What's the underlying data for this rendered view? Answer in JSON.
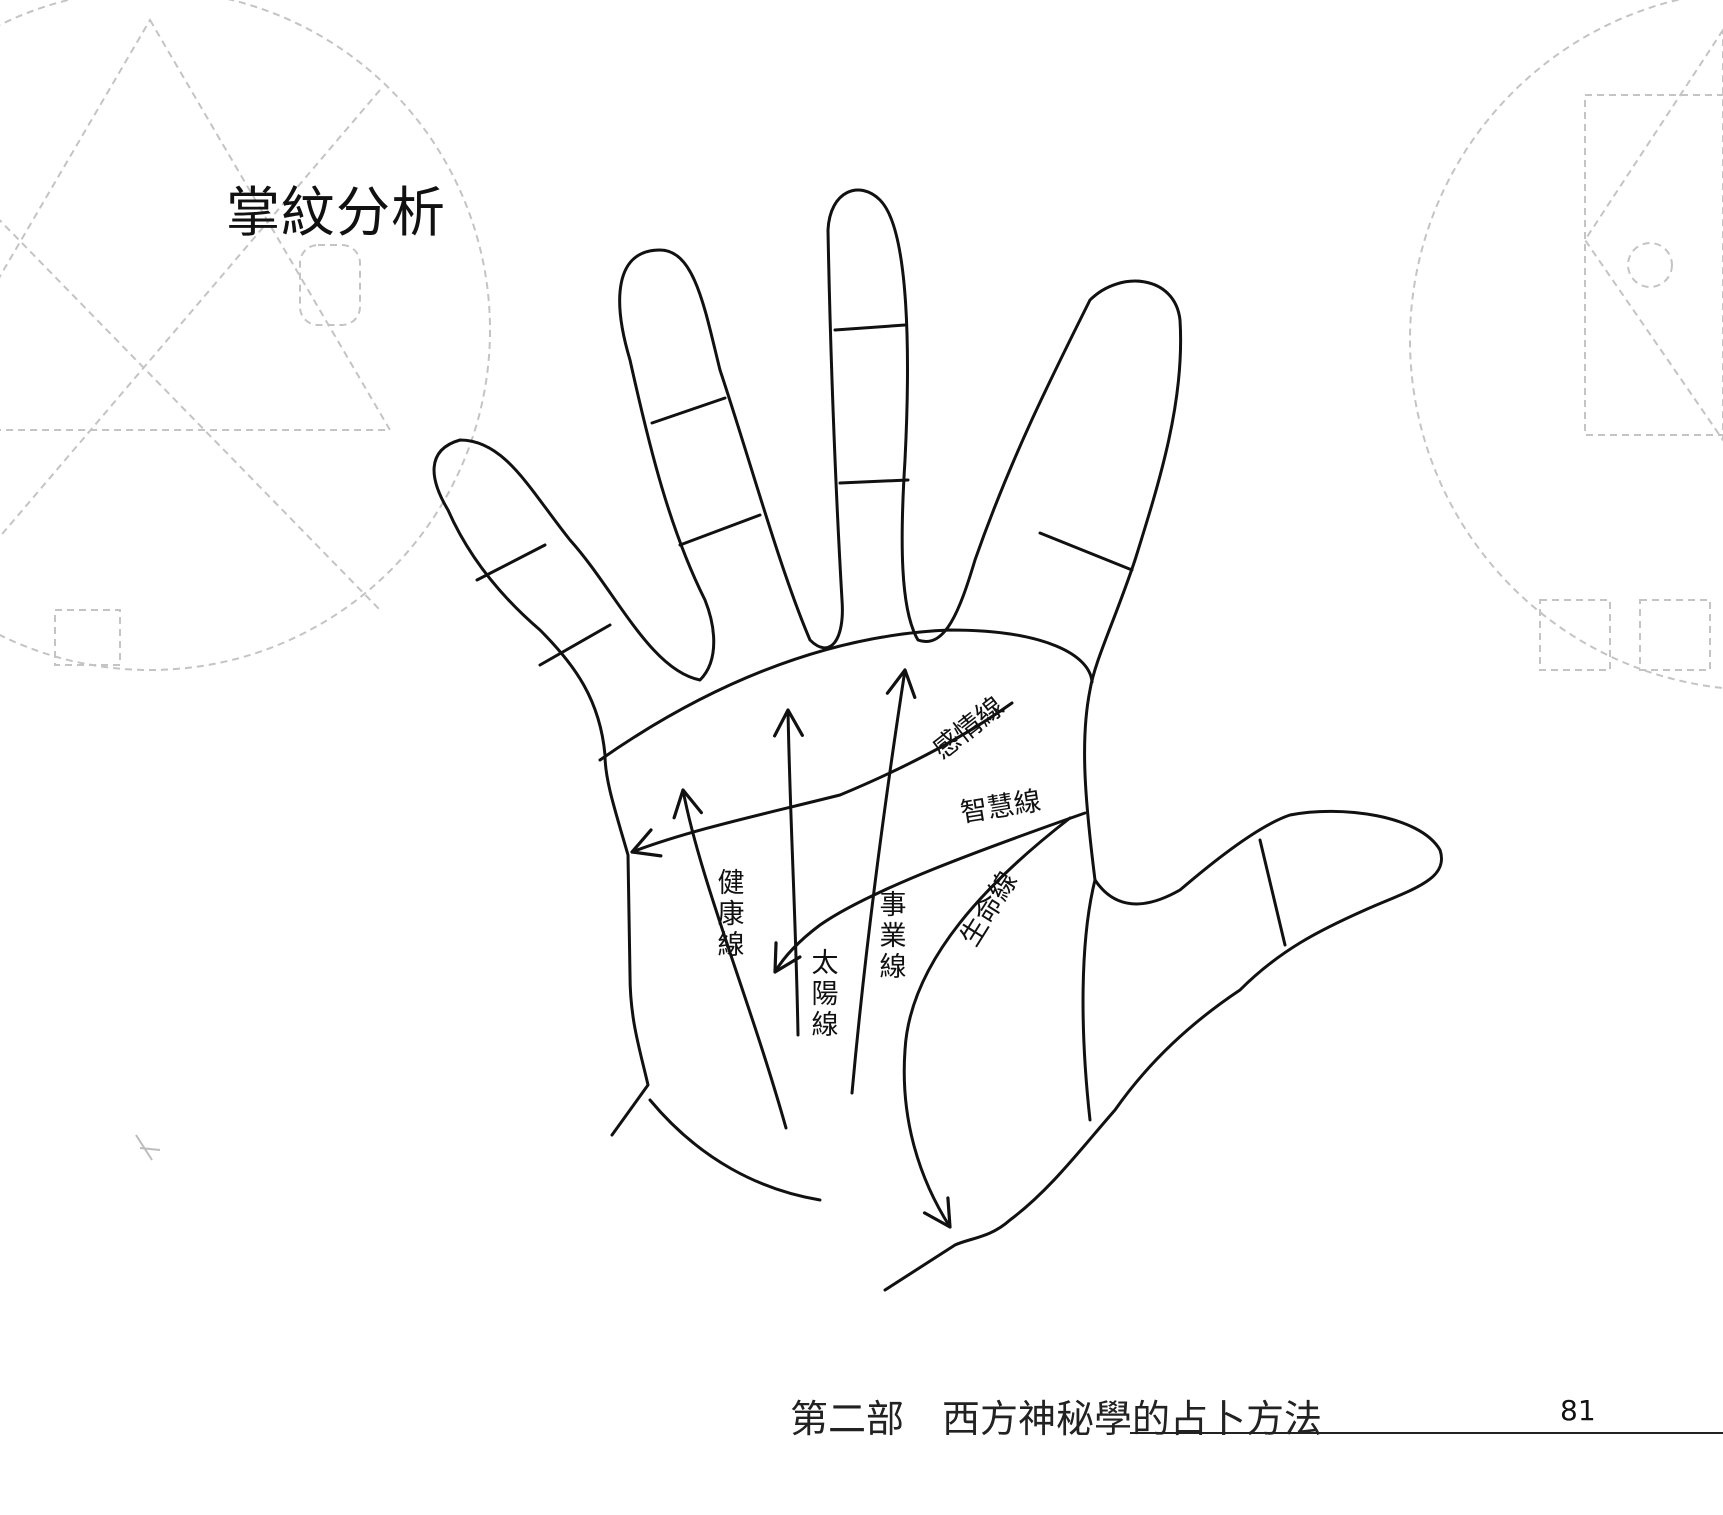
{
  "title": "掌紋分析",
  "lines": {
    "heart": "感情線",
    "head": "智慧線",
    "health": "健康線",
    "sun": "太陽線",
    "fate": "事業線",
    "life": "生命線"
  },
  "footer": {
    "chapter": "第二部　西方神秘學的占卜方法",
    "page_number": "81"
  },
  "colors": {
    "ink": "#111111",
    "faint": "#bbbbbb"
  }
}
